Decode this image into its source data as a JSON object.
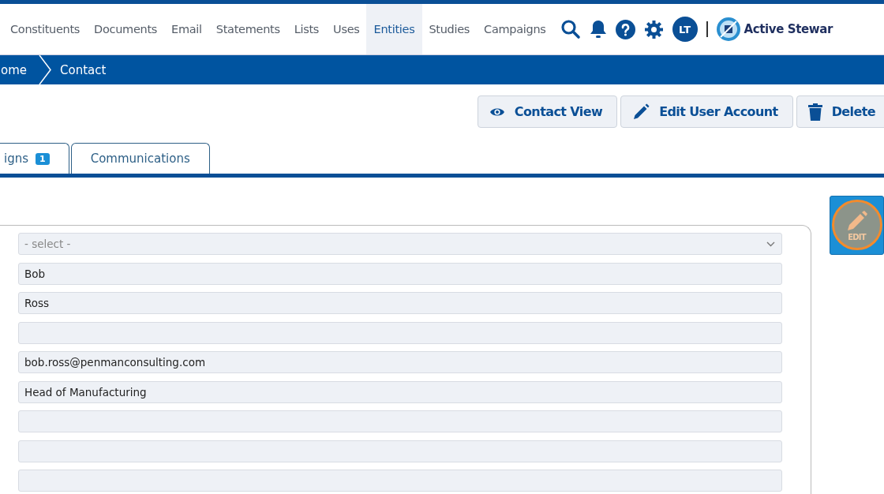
{
  "nav": {
    "items": [
      {
        "label": "Constituents",
        "selected": false
      },
      {
        "label": "Documents",
        "selected": false
      },
      {
        "label": "Email",
        "selected": false
      },
      {
        "label": "Statements",
        "selected": false
      },
      {
        "label": "Lists",
        "selected": false
      },
      {
        "label": "Uses",
        "selected": false
      },
      {
        "label": "Entities",
        "selected": true
      },
      {
        "label": "Studies",
        "selected": false
      },
      {
        "label": "Campaigns",
        "selected": false
      }
    ],
    "avatar": "LT",
    "brand": "Active Stewar"
  },
  "breadcrumb": [
    "ome",
    "Contact"
  ],
  "actions": [
    {
      "label": "Contact View",
      "kind": "eye"
    },
    {
      "label": "Edit User Account",
      "kind": "pencil"
    },
    {
      "label": "Delete",
      "kind": "trash"
    }
  ],
  "tabs": [
    {
      "label": "igns",
      "badge": "1",
      "selected": false
    },
    {
      "label": "Communications",
      "selected": false
    }
  ],
  "edit_button": {
    "label": "EDIT"
  },
  "fields": [
    {
      "kind": "select",
      "placeholder": "- select -"
    },
    {
      "kind": "text",
      "value": "Bob"
    },
    {
      "kind": "text",
      "value": "Ross"
    },
    {
      "kind": "text"
    },
    {
      "kind": "text",
      "value": "bob.ross@penmanconsulting.com"
    },
    {
      "kind": "text",
      "value": "Head of Manufacturing"
    },
    {
      "kind": "text"
    },
    {
      "kind": "text"
    },
    {
      "kind": "text"
    }
  ]
}
